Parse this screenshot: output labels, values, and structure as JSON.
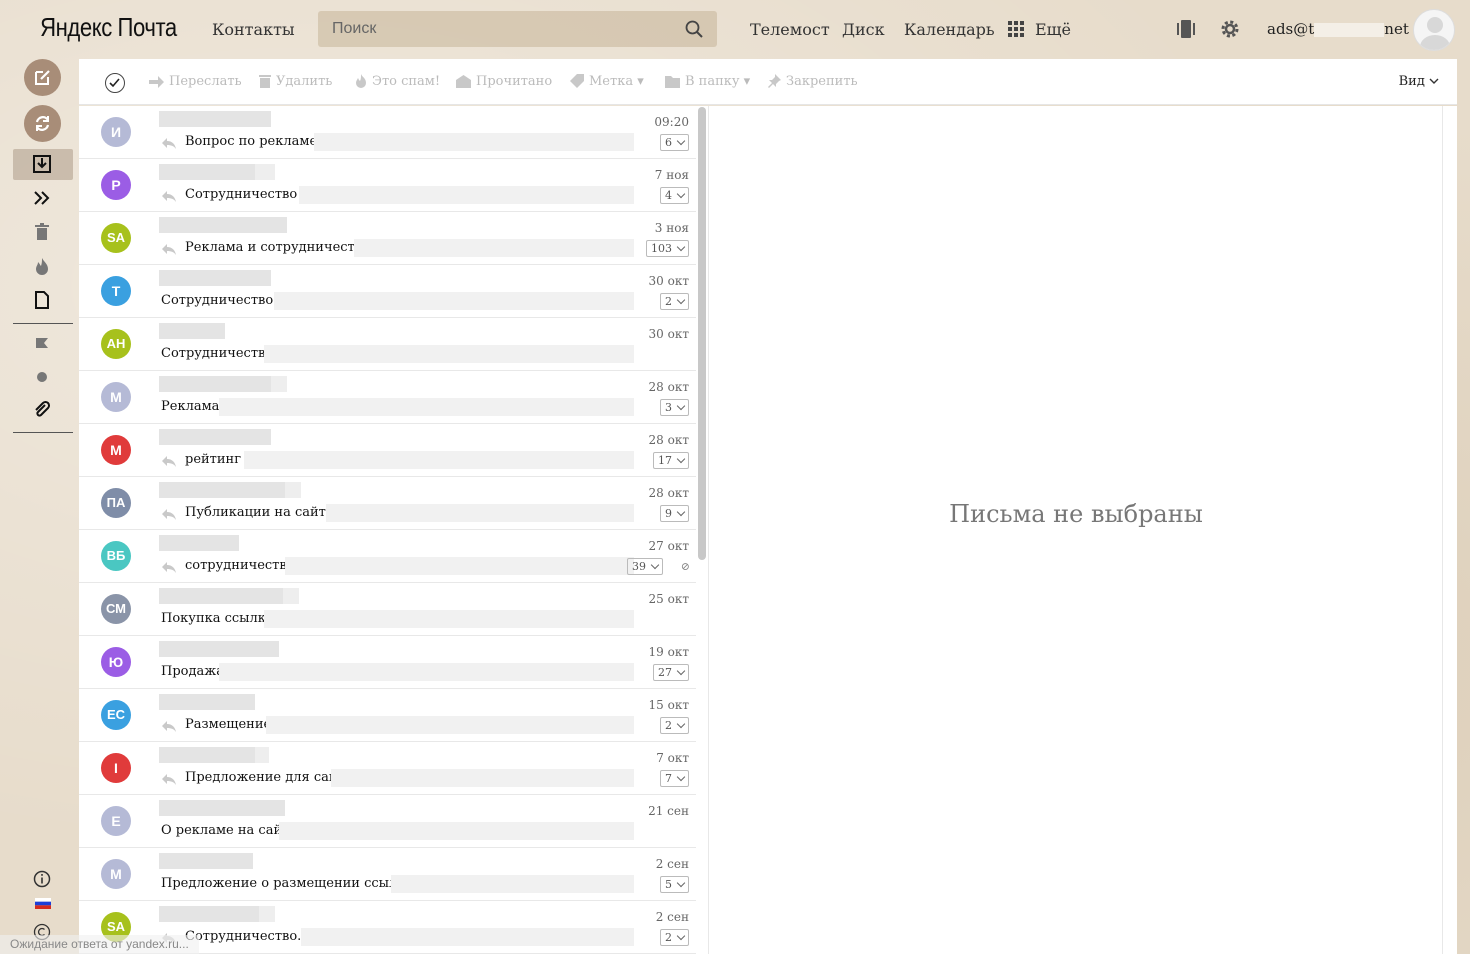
{
  "header": {
    "logo": "Яндекс Почта",
    "nav_contacts": "Контакты",
    "search_placeholder": "Поиск",
    "nav_telemost": "Телемост",
    "nav_disk": "Диск",
    "nav_calendar": "Календарь",
    "nav_more": "Ещё",
    "user_prefix": "ads@t",
    "user_suffix": "net"
  },
  "toolbar": {
    "forward": "Переслать",
    "delete": "Удалить",
    "spam": "Это спам!",
    "read": "Прочитано",
    "label": "Метка",
    "folder": "В папку",
    "pin": "Закрепить",
    "view": "Вид"
  },
  "messages": [
    {
      "initials": "И",
      "color": "#b5bad6",
      "subject": "Вопрос по рекламе",
      "date": "09:20",
      "count": "6",
      "reply": true
    },
    {
      "initials": "Р",
      "color": "#9b5de5",
      "subject": "Сотрудничество",
      "date": "7 ноя",
      "count": "4",
      "reply": true
    },
    {
      "initials": "SA",
      "color": "#a7c11c",
      "subject": "Реклама и сотрудничество",
      "date": "3 ноя",
      "count": "103",
      "reply": true
    },
    {
      "initials": "Т",
      "color": "#3aa0e0",
      "subject": "Сотрудничество",
      "date": "30 окт",
      "count": "2",
      "reply": false
    },
    {
      "initials": "АН",
      "color": "#a7c11c",
      "subject": "Сотрудничество с",
      "date": "30 окт",
      "count": "",
      "reply": false
    },
    {
      "initials": "М",
      "color": "#b5bad6",
      "subject": "Реклама",
      "date": "28 окт",
      "count": "3",
      "reply": false
    },
    {
      "initials": "М",
      "color": "#e03b3b",
      "subject": "рейтинг",
      "date": "28 окт",
      "count": "17",
      "reply": true
    },
    {
      "initials": "ПА",
      "color": "#7f8da8",
      "subject": "Публикации на сайте",
      "date": "28 окт",
      "count": "9",
      "reply": true
    },
    {
      "initials": "ВБ",
      "color": "#4ac7c2",
      "subject": "сотрудничество",
      "date": "27 окт",
      "count": "39",
      "reply": true,
      "clip": true
    },
    {
      "initials": "СМ",
      "color": "#8a94a8",
      "subject": "Покупка ссылки",
      "date": "25 окт",
      "count": "",
      "reply": false
    },
    {
      "initials": "Ю",
      "color": "#9b5de5",
      "subject": "Продажа",
      "date": "19 окт",
      "count": "27",
      "reply": false
    },
    {
      "initials": "ЕС",
      "color": "#3aa0e0",
      "subject": "Размещение",
      "date": "15 окт",
      "count": "2",
      "reply": true
    },
    {
      "initials": "I",
      "color": "#e03b3b",
      "subject": "Предложение для сайта",
      "date": "7 окт",
      "count": "7",
      "reply": true
    },
    {
      "initials": "Е",
      "color": "#b5bad6",
      "subject": "О рекламе на сайте",
      "date": "21 сен",
      "count": "",
      "reply": false
    },
    {
      "initials": "М",
      "color": "#b5bad6",
      "subject": "Предложение о размещении ссылки",
      "date": "2 сен",
      "count": "5",
      "reply": false
    },
    {
      "initials": "SA",
      "color": "#a7c11c",
      "subject": "Сотрудничество.",
      "date": "2 сен",
      "count": "2",
      "reply": true
    }
  ],
  "preview": {
    "empty_text": "Письма не выбраны"
  },
  "status_bar": "Ожидание ответа от yandex.ru..."
}
